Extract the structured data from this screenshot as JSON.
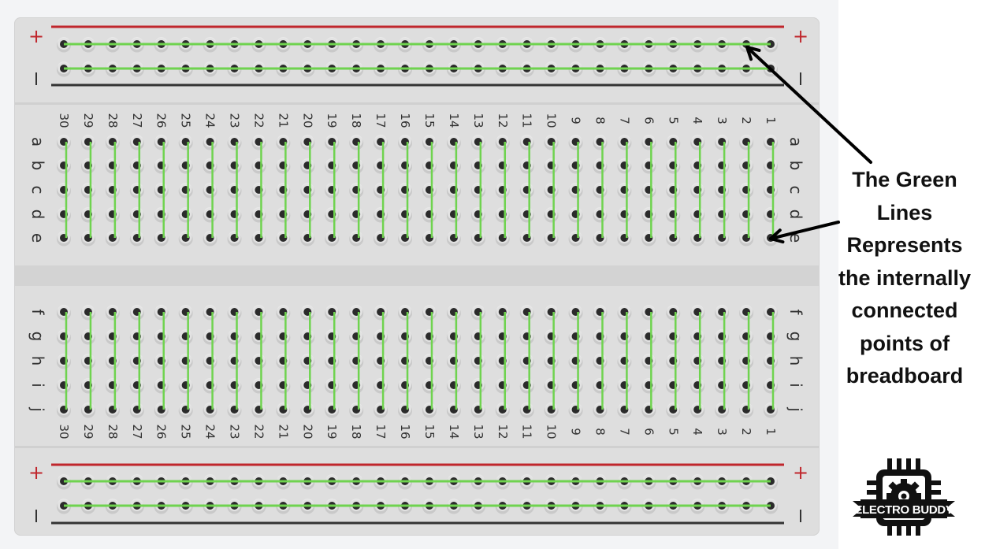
{
  "breadboard": {
    "columns": [
      30,
      29,
      28,
      27,
      26,
      25,
      24,
      23,
      22,
      21,
      20,
      19,
      18,
      17,
      16,
      15,
      14,
      13,
      12,
      11,
      10,
      9,
      8,
      7,
      6,
      5,
      4,
      3,
      2,
      1
    ],
    "top_rows": [
      "a",
      "b",
      "c",
      "d",
      "e"
    ],
    "bottom_rows": [
      "f",
      "g",
      "h",
      "i",
      "j"
    ],
    "rail_plus_label": "+",
    "rail_minus_label": "–",
    "colors": {
      "connection_line": "#6fd34f",
      "rail_positive": "#c0262c",
      "rail_negative": "#333333",
      "hole": "#2b2b2b",
      "board": "#dedede"
    }
  },
  "annotation": {
    "lines": [
      "The Green",
      "Lines",
      "Represents",
      "the internally",
      "connected",
      "points of",
      "breadboard"
    ]
  },
  "logo": {
    "text": "ELECTRO BUDDY",
    "icon": "chip-gear-icon"
  }
}
